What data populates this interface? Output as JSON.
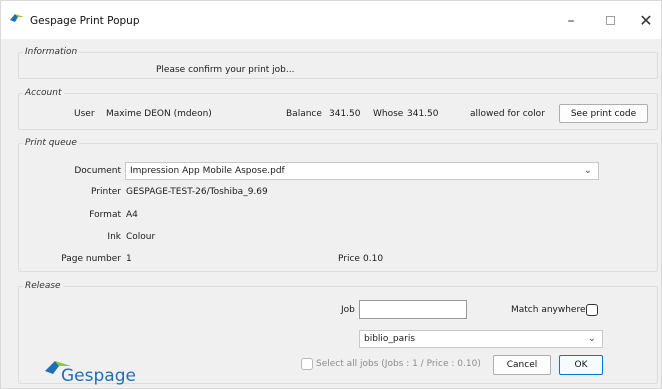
{
  "window": {
    "title": "Gespage Print Popup"
  },
  "information": {
    "legend": "Information",
    "message": "Please confirm your print job..."
  },
  "account": {
    "legend": "Account",
    "user_label": "User",
    "user_value": "Maxime DEON (mdeon)",
    "balance_label": "Balance",
    "balance_value": "341.50",
    "whose_label": "Whose",
    "whose_value": "341.50",
    "color_label": "allowed for color",
    "print_code_button": "See print code"
  },
  "print_queue": {
    "legend": "Print queue",
    "document_label": "Document",
    "document_value": "Impression App Mobile Aspose.pdf",
    "printer_label": "Printer",
    "printer_value": "GESPAGE-TEST-26/Toshiba_9.69",
    "format_label": "Format",
    "format_value": "A4",
    "ink_label": "Ink",
    "ink_value": "Colour",
    "page_number_label": "Page number",
    "page_number_value": "1",
    "price_label": "Price",
    "price_value": "0.10"
  },
  "release": {
    "legend": "Release",
    "job_label": "Job",
    "job_value": "",
    "match_anywhere_label": "Match anywhere",
    "match_anywhere_checked": false,
    "queue_value": "biblio_paris",
    "select_all_label": "Select all jobs (Jobs : 1 / Price : 0.10)",
    "select_all_checked": false,
    "cancel_button": "Cancel",
    "ok_button": "OK"
  },
  "brand": {
    "name": "Gespage",
    "color": "#1f6fb2",
    "accent": "#8cc63f"
  }
}
